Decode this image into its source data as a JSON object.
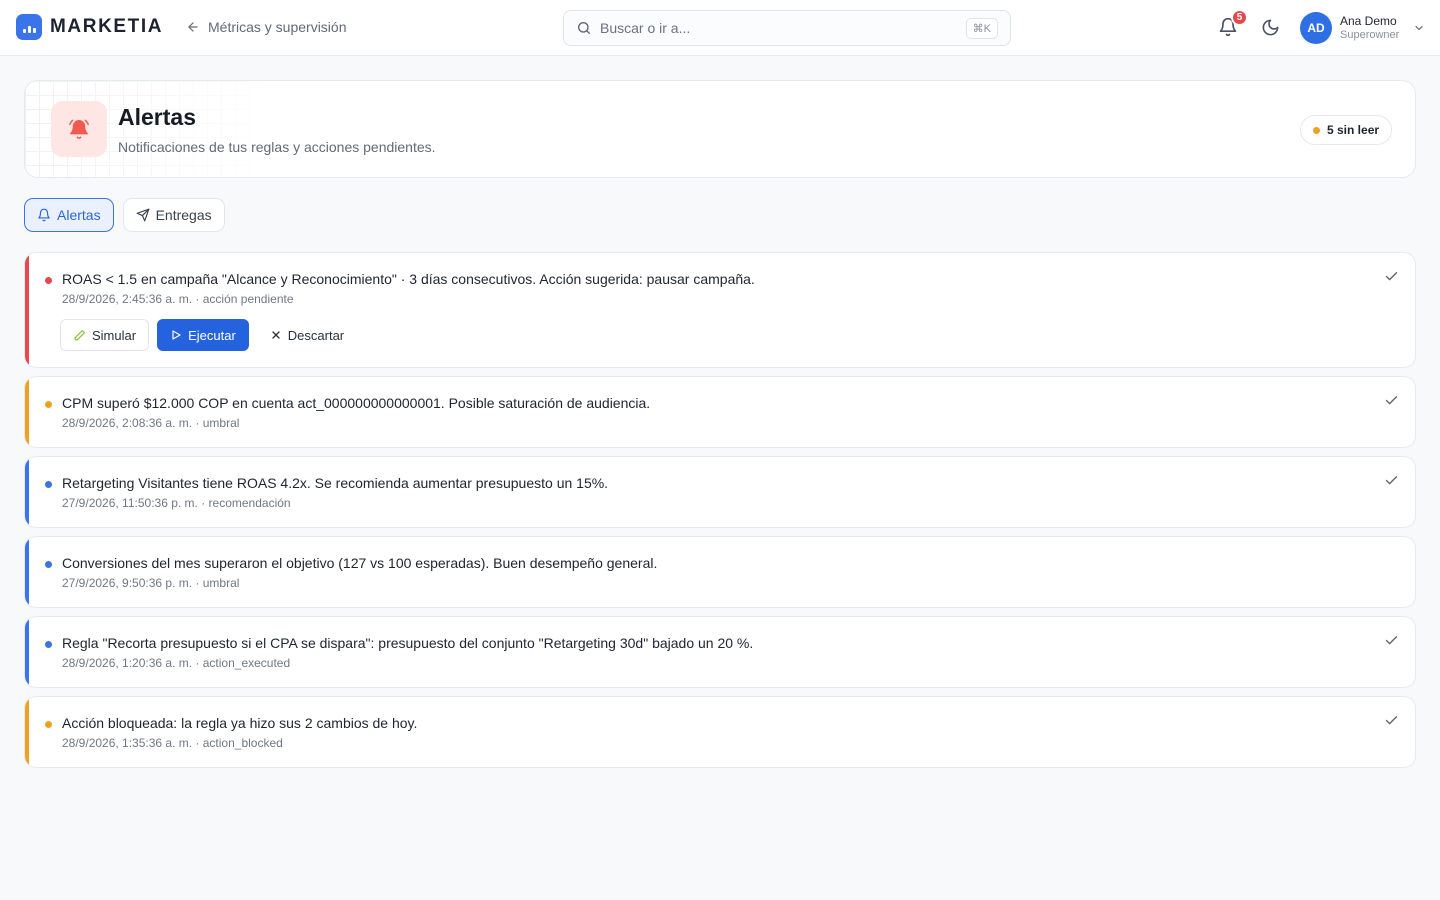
{
  "app": {
    "brand": "MARKETIA"
  },
  "topbar": {
    "back_label": "Métricas y supervisión",
    "search_placeholder": "Buscar o ir a...",
    "search_shortcut": "⌘K",
    "notifications_count": "5",
    "user": {
      "initials": "AD",
      "name": "Ana Demo",
      "role": "Superowner"
    }
  },
  "header": {
    "title": "Alertas",
    "subtitle": "Notificaciones de tus reglas y acciones pendientes.",
    "unread_label": "5 sin leer"
  },
  "tabs": [
    {
      "label": "Alertas",
      "active": true,
      "icon": "bell-icon"
    },
    {
      "label": "Entregas",
      "active": false,
      "icon": "send-icon"
    }
  ],
  "colors": {
    "red": "#e5484d",
    "amber": "#f0a020",
    "blue": "#3b74e8",
    "accent": "#2462de"
  },
  "alerts": [
    {
      "severity": "red",
      "message": "ROAS < 1.5 en campaña \"Alcance y Reconocimiento\" · 3 días consecutivos. Acción sugerida: pausar campaña.",
      "meta": "28/9/2026, 2:45:36 a. m. · acción pendiente",
      "read_check": true,
      "actions": {
        "simulate": "Simular",
        "execute": "Ejecutar",
        "dismiss": "Descartar"
      }
    },
    {
      "severity": "amber",
      "message": "CPM superó $12.000 COP en cuenta act_000000000000001. Posible saturación de audiencia.",
      "meta": "28/9/2026, 2:08:36 a. m. · umbral",
      "read_check": true
    },
    {
      "severity": "blue",
      "message": "Retargeting Visitantes tiene ROAS 4.2x. Se recomienda aumentar presupuesto un 15%.",
      "meta": "27/9/2026, 11:50:36 p. m. · recomendación",
      "read_check": true
    },
    {
      "severity": "blue",
      "message": "Conversiones del mes superaron el objetivo (127 vs 100 esperadas). Buen desempeño general.",
      "meta": "27/9/2026, 9:50:36 p. m. · umbral",
      "read_check": false
    },
    {
      "severity": "blue",
      "message": "Regla \"Recorta presupuesto si el CPA se dispara\": presupuesto del conjunto \"Retargeting 30d\" bajado un 20 %.",
      "meta": "28/9/2026, 1:20:36 a. m. · action_executed",
      "read_check": true
    },
    {
      "severity": "amber",
      "message": "Acción bloqueada: la regla ya hizo sus 2 cambios de hoy.",
      "meta": "28/9/2026, 1:35:36 a. m. · action_blocked",
      "read_check": true
    }
  ]
}
